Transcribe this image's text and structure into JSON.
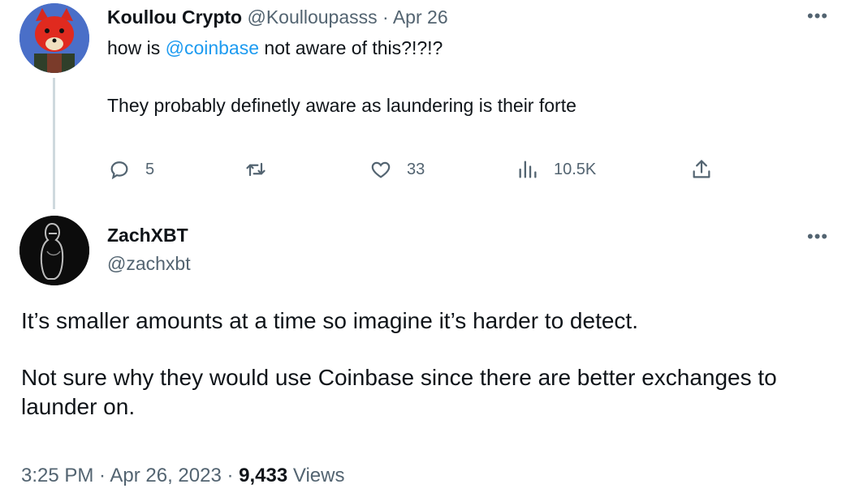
{
  "reply_tweet": {
    "author_name": "Koullou Crypto",
    "handle": "@Koulloupasss",
    "separator": "·",
    "date": "Apr 26",
    "more_label": "•••",
    "text_prefix": "how is ",
    "mention": "@coinbase",
    "text_suffix": " not aware of this?!?!?",
    "text_line2": "They probably definetly aware as laundering is their forte",
    "metrics": {
      "replies": "5",
      "retweets": "",
      "likes": "33",
      "views": "10.5K"
    },
    "icons": {
      "reply": "reply-icon",
      "retweet": "retweet-icon",
      "like": "heart-icon",
      "views": "analytics-icon",
      "share": "share-icon"
    }
  },
  "main_tweet": {
    "author_name": "ZachXBT",
    "handle": "@zachxbt",
    "more_label": "•••",
    "text_line1": "It’s smaller amounts at a time so imagine it’s harder to detect.",
    "text_line2": "Not sure why they would use Coinbase since there are better exchanges to launder on.",
    "timestamp": "3:25 PM · Apr 26, 2023 · ",
    "views_count": "9,433",
    "views_label": " Views"
  },
  "colors": {
    "link": "#1d9bf0",
    "secondary_text": "#536471",
    "primary_text": "#0f1419",
    "thread_line": "#cfd9de"
  }
}
